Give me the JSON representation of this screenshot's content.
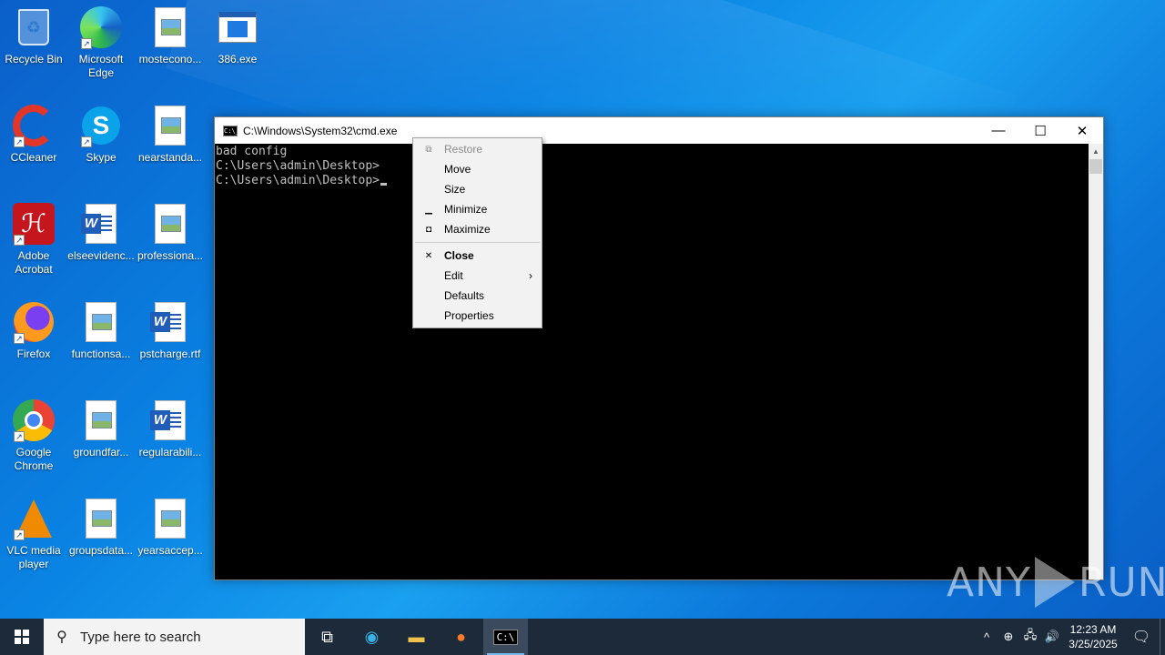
{
  "desktop": {
    "icons": [
      {
        "label": "Recycle Bin",
        "icon": "recycle-bin-icon"
      },
      {
        "label": "Microsoft Edge",
        "icon": "edge-icon"
      },
      {
        "label": "mosteconо...",
        "icon": "image-file-icon"
      },
      {
        "label": "386.exe",
        "icon": "exe-icon"
      },
      {
        "label": "CCleaner",
        "icon": "ccleaner-icon"
      },
      {
        "label": "Skype",
        "icon": "skype-icon"
      },
      {
        "label": "nearstanda...",
        "icon": "image-file-icon"
      },
      {
        "label": "Adobe Acrobat",
        "icon": "acrobat-icon"
      },
      {
        "label": "elseevidenc...",
        "icon": "word-doc-icon"
      },
      {
        "label": "professiona...",
        "icon": "image-file-icon"
      },
      {
        "label": "Firefox",
        "icon": "firefox-icon"
      },
      {
        "label": "functionsa...",
        "icon": "image-file-icon"
      },
      {
        "label": "pstcharge.rtf",
        "icon": "word-doc-icon"
      },
      {
        "label": "Google Chrome",
        "icon": "chrome-icon"
      },
      {
        "label": "groundfar...",
        "icon": "image-file-icon"
      },
      {
        "label": "regularabili...",
        "icon": "word-doc-icon"
      },
      {
        "label": "VLC media player",
        "icon": "vlc-icon"
      },
      {
        "label": "groupsdata...",
        "icon": "image-file-icon"
      },
      {
        "label": "yearsaccep...",
        "icon": "image-file-icon"
      }
    ]
  },
  "cmd_window": {
    "title": "C:\\Windows\\System32\\cmd.exe",
    "app_icon_text": "C:\\_",
    "minimize_glyph": "—",
    "maximize_glyph": "☐",
    "close_glyph": "✕",
    "console_lines": [
      "bad config",
      "",
      "C:\\Users\\admin\\Desktop>",
      "C:\\Users\\admin\\Desktop>"
    ]
  },
  "system_menu": {
    "items": [
      {
        "label": "Restore",
        "icon": "restore-icon",
        "glyph": "⧉",
        "disabled": true
      },
      {
        "label": "Move",
        "icon": "",
        "glyph": "",
        "disabled": false
      },
      {
        "label": "Size",
        "icon": "",
        "glyph": "",
        "disabled": false
      },
      {
        "label": "Minimize",
        "icon": "minimize-icon",
        "glyph": "▁",
        "disabled": false
      },
      {
        "label": "Maximize",
        "icon": "maximize-icon",
        "glyph": "◘",
        "disabled": false
      }
    ],
    "items2": [
      {
        "label": "Close",
        "icon": "close-icon",
        "glyph": "✕",
        "bold": true
      },
      {
        "label": "Edit",
        "submenu": true,
        "arrow": "›"
      },
      {
        "label": "Defaults"
      },
      {
        "label": "Properties"
      }
    ]
  },
  "watermark": {
    "left": "ANY",
    "right": "RUN"
  },
  "taskbar": {
    "search_placeholder": "Type here to search",
    "search_glyph": "⚲",
    "task_view_glyph": "⧉",
    "edge_glyph": "◉",
    "explorer_glyph": "▬",
    "firefox_glyph": "●",
    "cmd_glyph": "C:\\",
    "tray_chevron": "^",
    "tray_icons": [
      "⊕",
      "🖧",
      "🔊"
    ],
    "time": "12:23 AM",
    "date": "3/25/2025",
    "notification_glyph": "🗨"
  },
  "colors": {
    "console_bg": "#000000",
    "console_fg": "#c0c0c0",
    "taskbar_bg": "#1c2a3a"
  }
}
